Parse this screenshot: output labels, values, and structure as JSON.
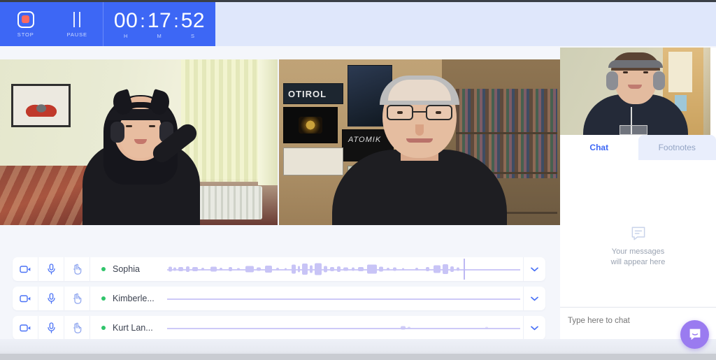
{
  "recorder": {
    "stop_label": "STOP",
    "pause_label": "PAUSE",
    "stop_icon": "stop-square-icon",
    "pause_icon": "pause-bars-icon",
    "timer": {
      "hours": "00",
      "minutes": "17",
      "seconds": "52",
      "h_label": "H",
      "m_label": "M",
      "s_label": "S",
      "separator": ":",
      "display": "00:17:52"
    },
    "accent_color": "#3d67f5",
    "header_bg": "#dfe7fb",
    "stop_dot_color": "#fc6a60"
  },
  "stage": {
    "tiles": [
      {
        "name": "sophia-video-tile",
        "poster_text": ""
      },
      {
        "name": "kurt-video-tile",
        "poster_text": "OTIROL",
        "poster_text_2": "ATOMIK"
      }
    ]
  },
  "right_panel": {
    "selfview_name": "self-view-video",
    "tabs": [
      {
        "label": "Chat",
        "active": true
      },
      {
        "label": "Footnotes",
        "active": false
      }
    ],
    "empty_state": {
      "icon": "message-bubble-icon",
      "line1": "Your messages",
      "line2": "will appear here"
    },
    "chat_input_placeholder": "Type here to chat",
    "chat_input_value": "",
    "intercom_icon": "intercom-messenger-icon",
    "intercom_color": "#9a7bf0",
    "active_tab_color": "#3d67f5",
    "inactive_tab_color": "#93a4c4"
  },
  "participants": {
    "status_color": "#30c46b",
    "waveform_color": "#c8c4f6",
    "rows": [
      {
        "name": "Sophia",
        "status": "online",
        "camera_icon": "video-camera-icon",
        "mic_icon": "microphone-icon",
        "hand_icon": "raise-hand-icon",
        "expand_icon": "chevron-down-icon",
        "has_waveform": true,
        "has_playhead": true
      },
      {
        "name": "Kimberle...",
        "status": "online",
        "camera_icon": "video-camera-icon",
        "mic_icon": "microphone-icon",
        "hand_icon": "raise-hand-icon",
        "expand_icon": "chevron-down-icon",
        "has_waveform": false,
        "has_playhead": false
      },
      {
        "name": "Kurt Lan...",
        "status": "online",
        "camera_icon": "video-camera-icon",
        "mic_icon": "microphone-icon",
        "hand_icon": "raise-hand-icon",
        "expand_icon": "chevron-down-icon",
        "has_waveform": true,
        "has_playhead": false
      }
    ]
  }
}
